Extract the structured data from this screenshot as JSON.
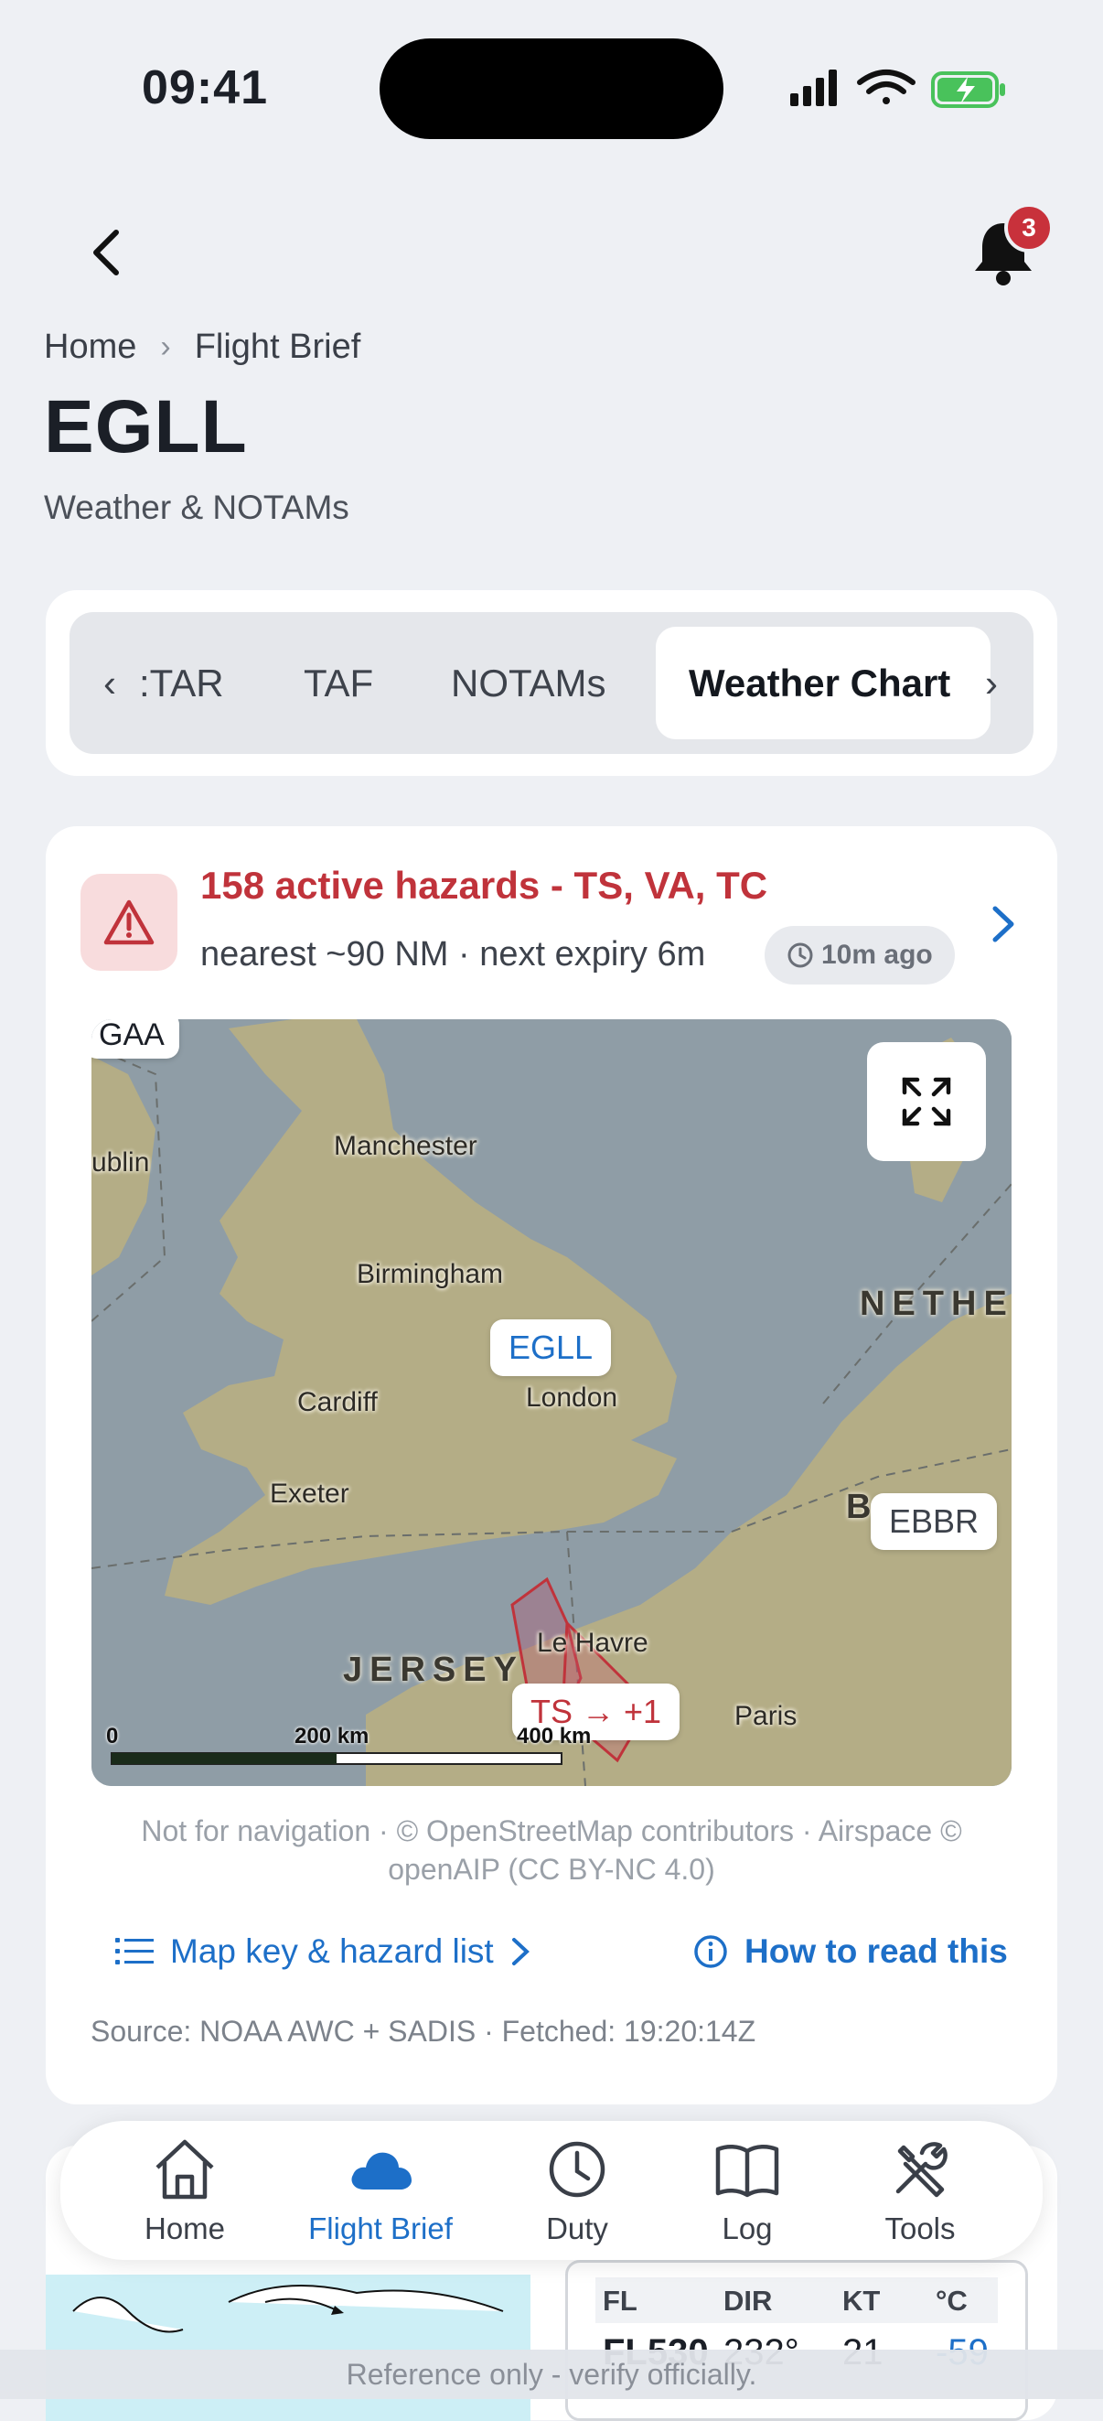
{
  "status_bar": {
    "time": "09:41"
  },
  "header": {
    "notifications_count": "3",
    "breadcrumb": [
      "Home",
      "Flight Brief"
    ],
    "title": "EGLL",
    "subtitle": "Weather & NOTAMs"
  },
  "tabs": {
    "items": [
      ":TAR",
      "TAF",
      "NOTAMs",
      "Weather Chart"
    ],
    "active": "Weather Chart"
  },
  "hazard": {
    "title": "158 active hazards - TS, VA, TC",
    "subtitle": "nearest ~90 NM · next expiry 6m",
    "age": "10m ago"
  },
  "map": {
    "labels": {
      "gaa": "GAA",
      "dublin": "ublin",
      "manchester": "Manchester",
      "birmingham": "Birmingham",
      "cardiff": "Cardiff",
      "london": "London",
      "exeter": "Exeter",
      "le_havre": "Le Havre",
      "paris": "Paris",
      "jersey": "JERSEY",
      "nethe": "NETHE",
      "belgium": "B         U"
    },
    "airport_egll": "EGLL",
    "airport_ebbr": "EBBR",
    "hazard_tag": "TS → +1",
    "scale": [
      "0",
      "200 km",
      "400 km"
    ]
  },
  "attribution": "Not for navigation · © OpenStreetMap contributors · Airspace © openAIP (CC BY-NC 4.0)",
  "links": {
    "map_key": "Map key & hazard list",
    "how_to": "How to read this"
  },
  "source": "Source: NOAA AWC + SADIS · Fetched: 19:20:14Z",
  "winds_table": {
    "headers": [
      "FL",
      "DIR",
      "KT",
      "°C"
    ],
    "row": [
      "FL530",
      "232°",
      "21",
      "-59"
    ]
  },
  "nav": {
    "items": [
      {
        "label": "Home",
        "icon": "home-icon"
      },
      {
        "label": "Flight Brief",
        "icon": "cloud-icon"
      },
      {
        "label": "Duty",
        "icon": "clock-icon"
      },
      {
        "label": "Log",
        "icon": "book-icon"
      },
      {
        "label": "Tools",
        "icon": "tools-icon"
      }
    ],
    "active": "Flight Brief"
  },
  "footer_note": "Reference only - verify officially.",
  "colors": {
    "accent": "#1d6fc8",
    "danger": "#c0333b",
    "background": "#eef0f4"
  }
}
